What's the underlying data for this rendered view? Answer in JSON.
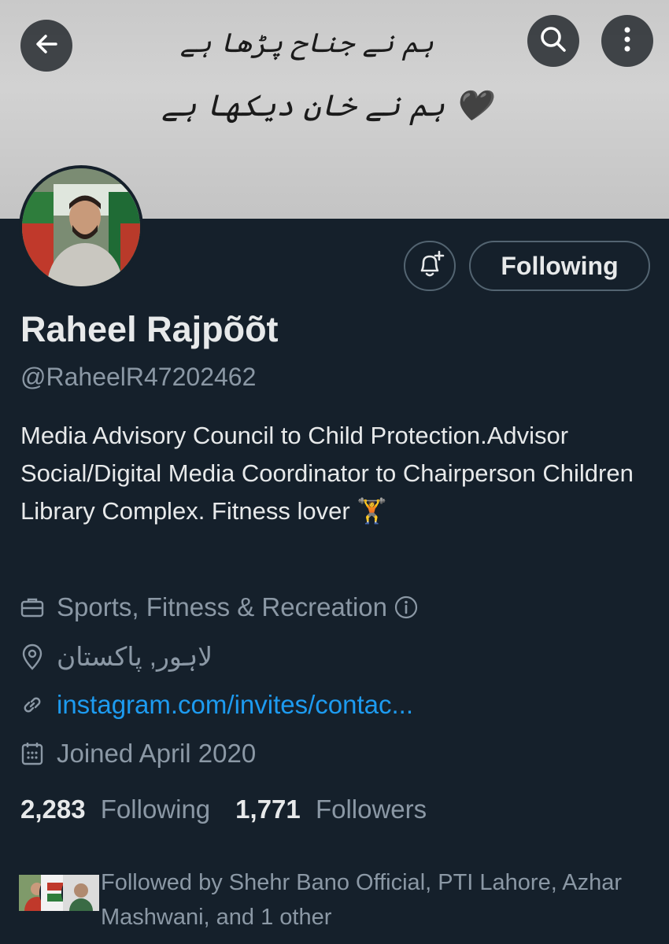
{
  "banner": {
    "line1": "ہم نے جناح پڑھا ہے",
    "line2": "ہم نے خان دیکھا ہے 🖤"
  },
  "top_bar": {
    "back_icon": "arrow-left-icon",
    "search_icon": "search-icon",
    "more_icon": "more-vertical-icon"
  },
  "actions": {
    "notify_icon": "bell-plus-icon",
    "following_label": "Following"
  },
  "profile": {
    "name": "Raheel Rajpõõt",
    "handle": "@RaheelR47202462",
    "bio": "Media Advisory Council to Child Protection.Advisor Social/Digital Media Coordinator to Chairperson Children Library Complex. Fitness lover 🏋️",
    "category": "Sports, Fitness & Recreation",
    "location": "لاہور, پاکستان",
    "website": "instagram.com/invites/contac...",
    "joined": "Joined April 2020"
  },
  "stats": {
    "following_count": "2,283",
    "following_label": "Following",
    "followers_count": "1,771",
    "followers_label": "Followers"
  },
  "followed_by": {
    "text": "Followed by Shehr Bano Official, PTI Lahore, Azhar Mashwani, and 1 other"
  },
  "colors": {
    "background": "#15202b",
    "text_primary": "#e7e9ea",
    "text_secondary": "#8b98a5",
    "link": "#1d9bf0",
    "border": "#536471"
  }
}
